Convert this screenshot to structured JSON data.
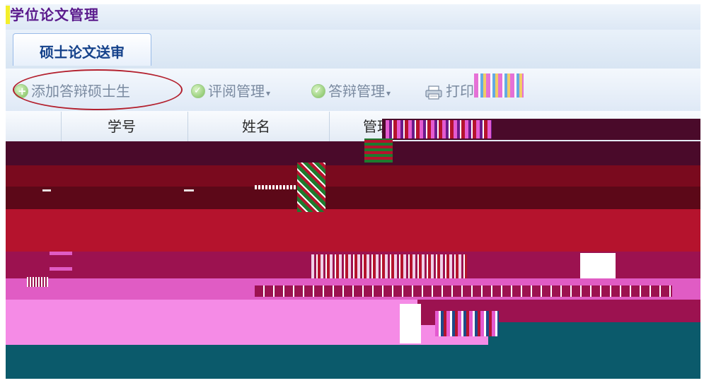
{
  "app": {
    "title": "学位论文管理"
  },
  "tabs": [
    {
      "label": "硕士论文送审",
      "active": true
    }
  ],
  "toolbar": {
    "add_label": "添加答辩硕士生",
    "review_label": "评阅管理",
    "defense_label": "答辩管理",
    "print_label": "打印"
  },
  "grid": {
    "columns": [
      "学号",
      "姓名",
      "管理"
    ]
  },
  "colors": {
    "title_text": "#5a1a8c",
    "tab_text": "#15428b",
    "toolbar_text": "#7a8aa0",
    "highlight_oval": "#b3202e",
    "corrupt_dark_maroon": "#4a0a2a",
    "corrupt_crimson": "#b5132d",
    "corrupt_magenta": "#e05cc4",
    "corrupt_pink": "#f58be6",
    "corrupt_teal": "#0b5a6b"
  },
  "icons": {
    "add": "plus-circle-icon",
    "review": "check-circle-icon",
    "defense": "check-circle-icon",
    "print": "printer-icon"
  }
}
